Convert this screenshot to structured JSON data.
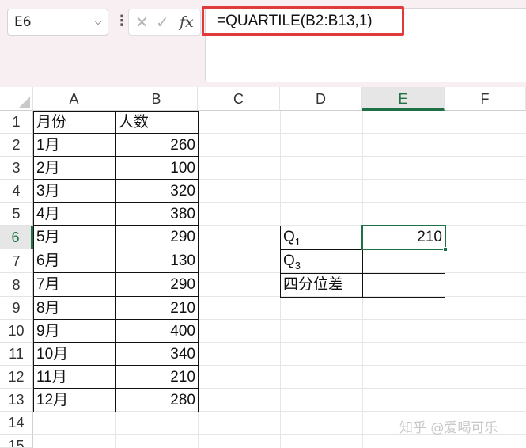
{
  "formula_bar": {
    "name_box": "E6",
    "dots": "⋮",
    "cancel_glyph": "✕",
    "enter_glyph": "✓",
    "fx_glyph": "fx",
    "formula": "=QUARTILE(B2:B13,1)"
  },
  "columns": [
    "A",
    "B",
    "C",
    "D",
    "E",
    "F"
  ],
  "rows": [
    "1",
    "2",
    "3",
    "4",
    "5",
    "6",
    "7",
    "8",
    "9",
    "10",
    "11",
    "12",
    "13",
    "14",
    "15"
  ],
  "selected_column": "E",
  "selected_row": "6",
  "table": {
    "header_month": "月份",
    "header_count": "人数",
    "months": [
      "1月",
      "2月",
      "3月",
      "4月",
      "5月",
      "6月",
      "7月",
      "8月",
      "9月",
      "10月",
      "11月",
      "12月"
    ],
    "counts": [
      "260",
      "100",
      "320",
      "380",
      "290",
      "130",
      "290",
      "210",
      "400",
      "340",
      "210",
      "280"
    ]
  },
  "stats": {
    "q1_letter": "Q",
    "q1_sub": "1",
    "q1_value": "210",
    "q3_letter": "Q",
    "q3_sub": "3",
    "iqr_label": "四分位差"
  },
  "watermark": "知乎 @爱喝可乐",
  "colors": {
    "accent": "#1e7145",
    "highlight": "#e03a3c"
  }
}
